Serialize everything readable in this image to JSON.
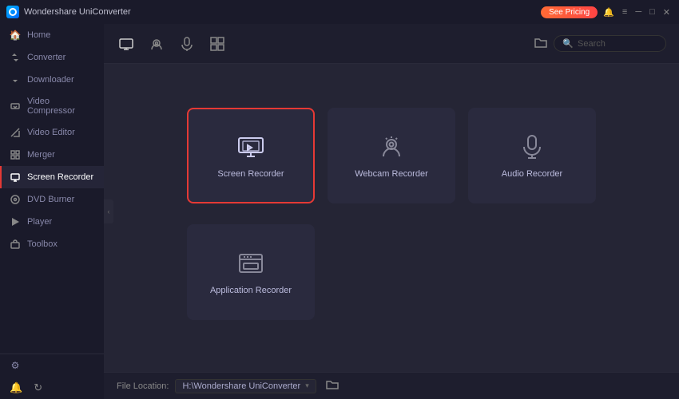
{
  "titleBar": {
    "appName": "Wondershare UniConverter",
    "seePricingLabel": "See Pricing",
    "windowControls": [
      "minimize",
      "maximize",
      "close"
    ]
  },
  "sidebar": {
    "items": [
      {
        "id": "home",
        "label": "Home",
        "icon": "🏠"
      },
      {
        "id": "converter",
        "label": "Converter",
        "icon": "⟳"
      },
      {
        "id": "downloader",
        "label": "Downloader",
        "icon": "↓"
      },
      {
        "id": "video-compressor",
        "label": "Video Compressor",
        "icon": "⤓"
      },
      {
        "id": "video-editor",
        "label": "Video Editor",
        "icon": "✂"
      },
      {
        "id": "merger",
        "label": "Merger",
        "icon": "⊞"
      },
      {
        "id": "screen-recorder",
        "label": "Screen Recorder",
        "icon": "⬛",
        "active": true
      },
      {
        "id": "dvd-burner",
        "label": "DVD Burner",
        "icon": "💿"
      },
      {
        "id": "player",
        "label": "Player",
        "icon": "▶"
      },
      {
        "id": "toolbox",
        "label": "Toolbox",
        "icon": "⚙"
      }
    ],
    "bottomItems": [
      {
        "id": "settings",
        "icon": "⚙"
      },
      {
        "id": "notifications",
        "icon": "🔔"
      },
      {
        "id": "feedback",
        "icon": "↻"
      }
    ]
  },
  "toolbar": {
    "icons": [
      {
        "id": "screen-icon",
        "symbol": "▣"
      },
      {
        "id": "camera-icon",
        "symbol": "◎"
      },
      {
        "id": "mic-icon",
        "symbol": "🎤"
      },
      {
        "id": "apps-icon",
        "symbol": "⊞"
      }
    ],
    "searchPlaceholder": "Search"
  },
  "recorderCards": [
    {
      "id": "screen-recorder",
      "label": "Screen Recorder",
      "selected": true
    },
    {
      "id": "webcam-recorder",
      "label": "Webcam Recorder",
      "selected": false
    },
    {
      "id": "audio-recorder",
      "label": "Audio Recorder",
      "selected": false
    },
    {
      "id": "application-recorder",
      "label": "Application Recorder",
      "selected": false
    }
  ],
  "fileLocation": {
    "label": "File Location:",
    "path": "H:\\Wondershare UniConverter",
    "folderIcon": "📁"
  }
}
